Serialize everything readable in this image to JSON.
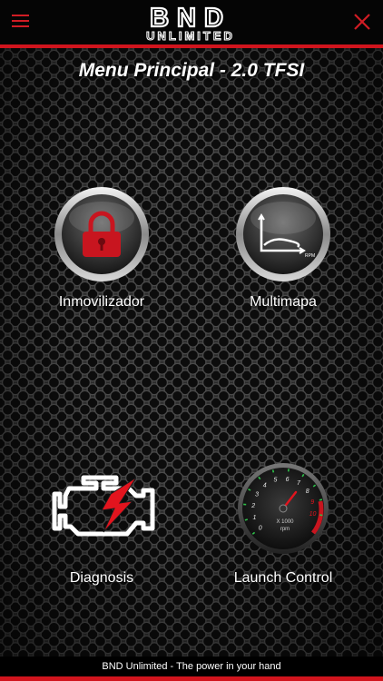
{
  "header": {
    "brand_top": "BND",
    "brand_bottom": "UNLIMITED",
    "menu_icon": "hamburger-icon",
    "close_icon": "close-icon",
    "accent_color": "#d1141d"
  },
  "page": {
    "title": "Menu Principal - 2.0 TFSI"
  },
  "tiles": [
    {
      "label": "Inmovilizador",
      "icon": "padlock-icon"
    },
    {
      "label": "Multimapa",
      "icon": "rpm-graph-icon",
      "icon_axis_label": "RPM"
    },
    {
      "label": "Diagnosis",
      "icon": "engine-warning-icon"
    },
    {
      "label": "Launch Control",
      "icon": "tachometer-icon",
      "gauge_ticks": [
        "0",
        "1",
        "2",
        "3",
        "4",
        "5",
        "6",
        "7",
        "8",
        "9",
        "10"
      ],
      "gauge_unit_top": "X 1000",
      "gauge_unit_bottom": "rpm"
    }
  ],
  "footer": {
    "text": "BND Unlimited - The power in your hand"
  }
}
